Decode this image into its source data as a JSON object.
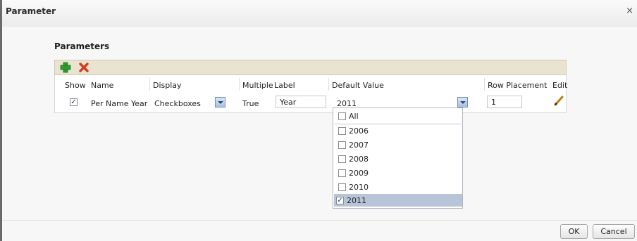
{
  "dialog": {
    "title": "Parameter",
    "close_glyph": "×"
  },
  "section": {
    "title": "Parameters"
  },
  "toolbar": {
    "add_icon": "add-icon",
    "delete_icon": "delete-icon",
    "add_color": "#2e9b2e",
    "delete_color": "#d93a1c"
  },
  "table": {
    "headers": [
      "Show",
      "Name",
      "Display",
      "Multiple",
      "Label",
      "Default Value",
      "Row Placement",
      "Edit"
    ],
    "rows": [
      {
        "show_checked": "✓",
        "name": "Per Name Year",
        "display": "Checkboxes",
        "multiple": "True",
        "label": "Year",
        "default_value": "2011",
        "row_placement": "1",
        "edit_icon": "pencil-icon"
      }
    ]
  },
  "default_value_dropdown": {
    "options": [
      {
        "label": "All",
        "checked": ""
      },
      {
        "label": "2006",
        "checked": ""
      },
      {
        "label": "2007",
        "checked": ""
      },
      {
        "label": "2008",
        "checked": ""
      },
      {
        "label": "2009",
        "checked": ""
      },
      {
        "label": "2010",
        "checked": ""
      },
      {
        "label": "2011",
        "checked": "✓"
      }
    ],
    "selected_highlight": "#b8c5d8"
  },
  "footer": {
    "ok_label": "OK",
    "cancel_label": "Cancel"
  }
}
